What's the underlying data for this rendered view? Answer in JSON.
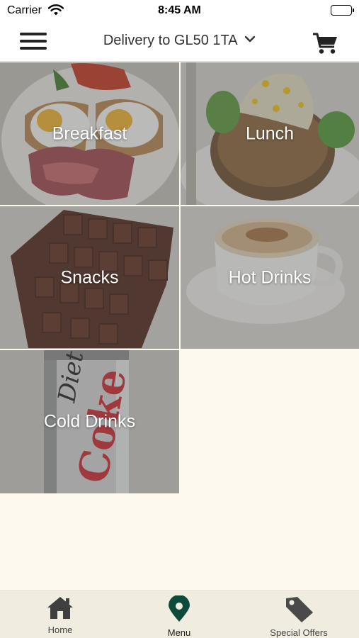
{
  "status_bar": {
    "carrier": "Carrier",
    "time": "8:45 AM"
  },
  "header": {
    "delivery_label": "Delivery to GL50 1TA"
  },
  "categories": [
    {
      "label": "Breakfast"
    },
    {
      "label": "Lunch"
    },
    {
      "label": "Snacks"
    },
    {
      "label": "Hot Drinks"
    },
    {
      "label": "Cold Drinks"
    }
  ],
  "cold_drinks_can": {
    "line1": "Diet",
    "line2": "Coke"
  },
  "tab_bar": {
    "active": "Menu",
    "tabs": [
      {
        "label": "Home",
        "icon": "home-icon"
      },
      {
        "label": "Menu",
        "icon": "map-pin-icon"
      },
      {
        "label": "Special Offers",
        "icon": "tag-icon"
      }
    ]
  },
  "colors": {
    "accent": "#0e4a3a",
    "background": "#fdf9ee",
    "tab_bar": "#f0ece0"
  }
}
